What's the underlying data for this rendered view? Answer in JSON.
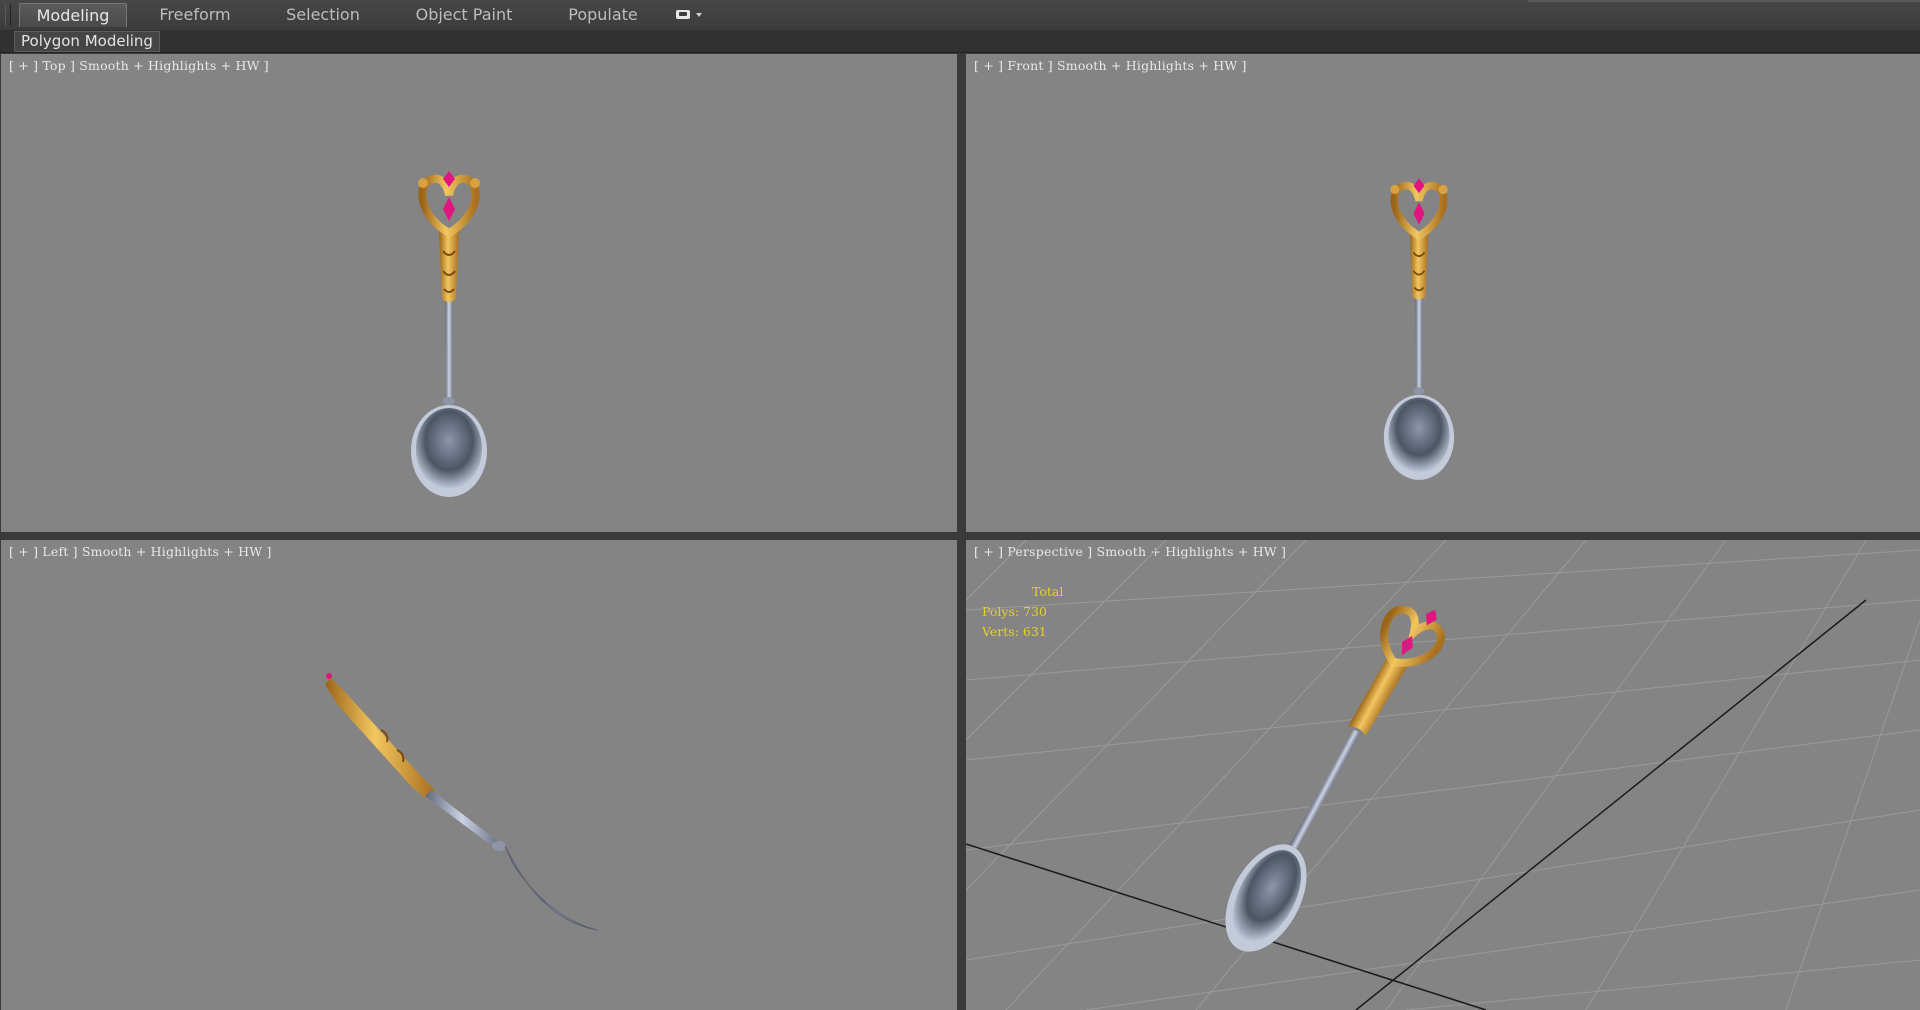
{
  "ribbon": {
    "tabs": [
      {
        "label": "Modeling",
        "active": true
      },
      {
        "label": "Freeform",
        "active": false
      },
      {
        "label": "Selection",
        "active": false
      },
      {
        "label": "Object Paint",
        "active": false
      },
      {
        "label": "Populate",
        "active": false
      }
    ],
    "dropdown_icon": "tab-dropdown-icon"
  },
  "panel": {
    "label": "Polygon Modeling"
  },
  "viewports": {
    "top": {
      "label": "[ + ] Top ] Smooth + Highlights + HW ]"
    },
    "front": {
      "label": "[ + ] Front ] Smooth + Highlights + HW ]"
    },
    "left": {
      "label": "[ + ] Left ] Smooth + Highlights + HW ]"
    },
    "perspective": {
      "label": "[ + ] Perspective ] Smooth + Highlights + HW ]"
    }
  },
  "stats": {
    "total_label": "Total",
    "polys": "Polys: 730",
    "verts": "Verts: 631",
    "color": "#e8cf2a"
  },
  "colors": {
    "viewport_bg": "#848484",
    "gold": "#d9a53c",
    "silver": "#a9b2c4",
    "gem": "#e0157f"
  }
}
